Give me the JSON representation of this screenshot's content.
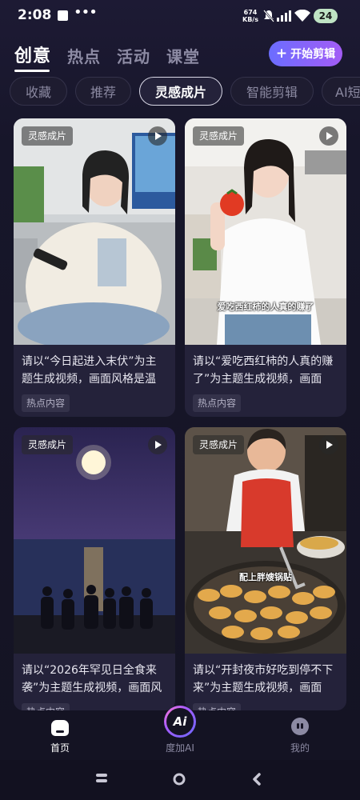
{
  "status_bar": {
    "time": "2:08",
    "net_speed_value": "674",
    "net_speed_unit": "KB/s",
    "battery": "24"
  },
  "top_tabs": [
    {
      "label": "创意",
      "active": true
    },
    {
      "label": "热点",
      "active": false
    },
    {
      "label": "活动",
      "active": false
    },
    {
      "label": "课堂",
      "active": false
    }
  ],
  "start_button": {
    "icon": "plus-icon",
    "label": "开始剪辑"
  },
  "chips": [
    {
      "label": "收藏",
      "active": false
    },
    {
      "label": "推荐",
      "active": false
    },
    {
      "label": "灵感成片",
      "active": true
    },
    {
      "label": "智能剪辑",
      "active": false
    },
    {
      "label": "AI短",
      "active": false
    }
  ],
  "cards": [
    {
      "tag": "灵感成片",
      "description": "请以“今日起进入末伏”为主题生成视频，画面风格是温柔...",
      "badge": "热点内容",
      "caption": ""
    },
    {
      "tag": "灵感成片",
      "description": "请以“爱吃西红柿的人真的赚了”为主题生成视频，画面风...",
      "badge": "热点内容",
      "caption": "爱吃西红柿的人真的赚了"
    },
    {
      "tag": "灵感成片",
      "description": "请以“2026年罕见日全食来袭”为主题生成视频，画面风格...",
      "badge": "热点内容",
      "caption": ""
    },
    {
      "tag": "灵感成片",
      "description": "请以“开封夜市好吃到停不下来”为主题生成视频，画面风...",
      "badge": "热点内容",
      "caption": "配上胖嫂锅贴"
    }
  ],
  "bottom_nav": [
    {
      "label": "首页",
      "icon": "home-icon",
      "active": true
    },
    {
      "label": "度加AI",
      "icon": "ai-icon",
      "icon_text": "Ai",
      "active": false
    },
    {
      "label": "我的",
      "icon": "profile-icon",
      "active": false
    }
  ],
  "colors": {
    "background": "#17162a",
    "accent_start": "#6b6dff",
    "accent_end": "#a35cf5",
    "card_bg": "#24223a"
  }
}
